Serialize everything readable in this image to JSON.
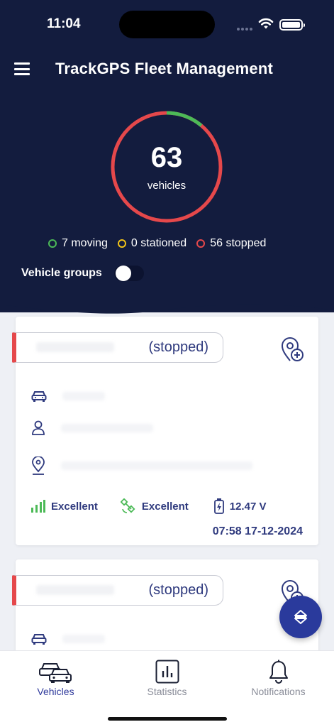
{
  "status_bar": {
    "time": "11:04"
  },
  "header": {
    "title": "TrackGPS Fleet Management"
  },
  "summary": {
    "total": "63",
    "total_label": "vehicles",
    "moving_count": 7,
    "stationed_count": 0,
    "stopped_count": 56,
    "legend": {
      "moving": "7 moving",
      "stationed": "0 stationed",
      "stopped": "56 stopped"
    },
    "colors": {
      "moving": "#4cba57",
      "stationed": "#f2c318",
      "stopped": "#e5484b"
    }
  },
  "groups": {
    "label": "Vehicle groups",
    "enabled": false
  },
  "vehicles": [
    {
      "status": "(stopped)",
      "gsm_signal": "Excellent",
      "gps_signal": "Excellent",
      "voltage": "12.47 V",
      "timestamp": "07:58 17-12-2024"
    },
    {
      "status": "(stopped)"
    }
  ],
  "tabs": [
    {
      "label": "Vehicles",
      "icon": "cars-icon",
      "active": true
    },
    {
      "label": "Statistics",
      "icon": "bar-chart-icon",
      "active": false
    },
    {
      "label": "Notifications",
      "icon": "bell-icon",
      "active": false
    }
  ],
  "theme": {
    "navy": "#131c3e",
    "accent": "#2f3a7e",
    "fab": "#2a3a9c"
  }
}
